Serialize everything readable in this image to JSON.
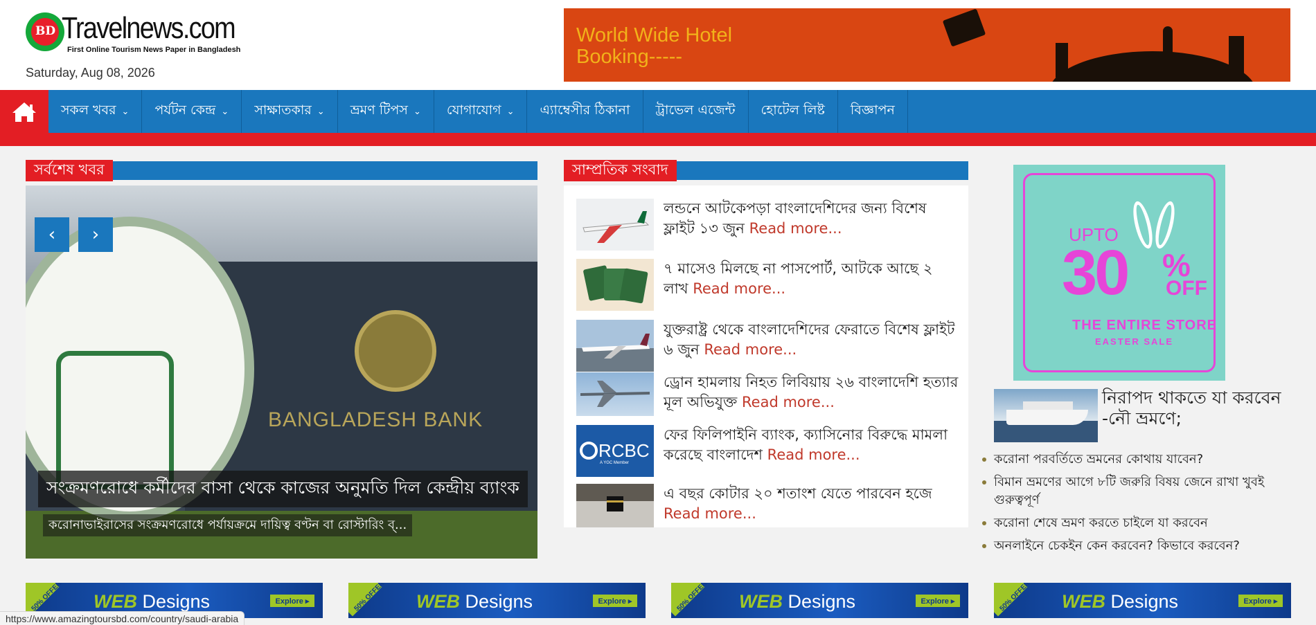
{
  "header": {
    "logo_bd": "BD",
    "logo_name": "Travelnews.com",
    "logo_tagline": "First Online Tourism News Paper in Bangladesh",
    "date": "Saturday, Aug 08, 2026",
    "banner_text": "World Wide Hotel\nBooking-----"
  },
  "nav": {
    "home_icon": "home-icon",
    "items": [
      {
        "label": "সকল খবর",
        "has_dropdown": true
      },
      {
        "label": "পর্যটন কেন্দ্র",
        "has_dropdown": true
      },
      {
        "label": "সাক্ষাতকার",
        "has_dropdown": true
      },
      {
        "label": "ভ্রমণ টিপস",
        "has_dropdown": true
      },
      {
        "label": "যোগাযোগ",
        "has_dropdown": true
      },
      {
        "label": "এ্যাম্বেসীর ঠিকানা",
        "has_dropdown": false
      },
      {
        "label": "ট্রাভেল এজেন্ট",
        "has_dropdown": false
      },
      {
        "label": "হোটেল লিষ্ট",
        "has_dropdown": false
      },
      {
        "label": "বিজ্ঞাপন",
        "has_dropdown": false
      }
    ]
  },
  "latest": {
    "heading": "সর্বশেষ খবর",
    "slide_bank_sign": "BANGLADESH BANK",
    "slide_caption": "সংক্রমণরোধে কর্মীদের বাসা থেকে কাজের অনুমতি দিল কেন্দ্রীয় ব্যাংক",
    "slide_excerpt": "করোনাভাইরাসের সংক্রমণরোধে পর্যায়ক্রমে দায়িত্ব বণ্টন বা রোস্টারিং ব্..."
  },
  "recent": {
    "heading": "সাম্প্রতিক সংবাদ",
    "read_more": "Read more...",
    "items": [
      {
        "text": "লন্ডনে আটকেপড়া বাংলাদেশিদের জন্য বিশেষ ফ্লাইট ১৩ জুন"
      },
      {
        "text": "৭ মাসেও মিলছে না পাসপোর্ট, আটকে আছে ২ লাখ"
      },
      {
        "text": "যুক্তরাষ্ট্র থেকে বাংলাদেশিদের ফেরাতে বিশেষ ফ্লাইট ৬ জুন"
      },
      {
        "text": "ড্রোন হামলায় নিহত লিবিয়ায় ২৬ বাংলাদেশি হত্যার মূল অভিযুক্ত"
      },
      {
        "text": "ফের ফিলিপাইনি ব্যাংক, ক্যাসিনোর বিরুদ্ধে মামলা করেছে বাংলাদেশ"
      },
      {
        "text": "এ বছর কোটার ২০ শতাংশ যেতে পারবেন হজে"
      }
    ],
    "rcbc_logo": "RCBC",
    "rcbc_sub": "A YGC Member"
  },
  "sidebar": {
    "ad": {
      "upto": "UPTO",
      "amount": "30",
      "percent": "%",
      "off": "OFF",
      "line": "THE ENTIRE STORE",
      "sub": "EASTER SALE"
    },
    "feature_title": "নিরাপদ থাকতে যা করবেন -নৌ ভ্রমণে;",
    "links": [
      "করোনা পরবর্তিতে ভ্রমনের কোথায় যাবেন?",
      "বিমান ভ্রমণের আগে ৮টি জরুরি বিষয় জেনে রাখা খুবই গুরুত্বপূর্ণ",
      "করোনা শেষে ভ্রমণ করতে চাইলে যা করবেন",
      "অনলাইনে চেকইন কেন করবেন? কিভাবে করবেন?"
    ]
  },
  "bottom_ads": {
    "offer": "50% OFFER",
    "web": "WEB",
    "designs": " Designs",
    "button": "Explore ▸"
  },
  "status_url": "https://www.amazingtoursbd.com/country/saudi-arabia",
  "colors": {
    "nav_blue": "#1a77bd",
    "accent_red": "#e31e24",
    "read_more": "#c0392b"
  }
}
